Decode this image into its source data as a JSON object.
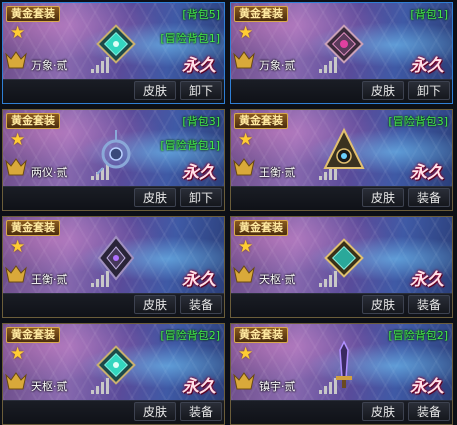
{
  "cards": [
    {
      "tag": "黄金套装",
      "name": "万象·贰",
      "forever": "永久",
      "bag1": "[背包5]",
      "bag2": "[冒险背包1]",
      "skin": "皮肤",
      "action": "卸下",
      "gem": "square-teal",
      "selected": true
    },
    {
      "tag": "黄金套装",
      "name": "万象·贰",
      "forever": "永久",
      "bag1": "[背包1]",
      "bag2": "",
      "skin": "皮肤",
      "action": "卸下",
      "gem": "square-pink",
      "selected": true
    },
    {
      "tag": "黄金套装",
      "name": "两仪·贰",
      "forever": "永久",
      "bag1": "[背包3]",
      "bag2": "[冒险背包1]",
      "skin": "皮肤",
      "action": "卸下",
      "gem": "ring-blue",
      "selected": false
    },
    {
      "tag": "黄金套装",
      "name": "王衡·贰",
      "forever": "永久",
      "bag1": "[冒险背包3]",
      "bag2": "",
      "skin": "皮肤",
      "action": "装备",
      "gem": "triangle-gold",
      "selected": false
    },
    {
      "tag": "黄金套装",
      "name": "王衡·贰",
      "forever": "永久",
      "bag1": "",
      "bag2": "",
      "skin": "皮肤",
      "action": "装备",
      "gem": "octa-dark",
      "selected": false
    },
    {
      "tag": "黄金套装",
      "name": "天枢·贰",
      "forever": "永久",
      "bag1": "",
      "bag2": "",
      "skin": "皮肤",
      "action": "装备",
      "gem": "square-gold",
      "selected": false
    },
    {
      "tag": "黄金套装",
      "name": "天枢·贰",
      "forever": "永久",
      "bag1": "[冒险背包2]",
      "bag2": "",
      "skin": "皮肤",
      "action": "装备",
      "gem": "square-teal",
      "selected": false
    },
    {
      "tag": "黄金套装",
      "name": "镇宇·贰",
      "forever": "永久",
      "bag1": "[冒险背包2]",
      "bag2": "",
      "skin": "皮肤",
      "action": "装备",
      "gem": "sword-purple",
      "selected": false
    }
  ],
  "colors": {
    "accent_green": "#45e84a",
    "gold": "#ffcc33",
    "selected_border": "#2f7fd6"
  }
}
